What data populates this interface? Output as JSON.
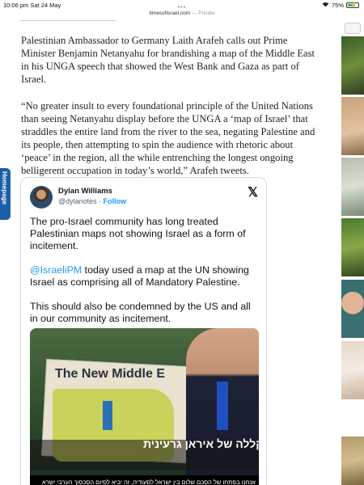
{
  "status": {
    "time": "10:06 pm",
    "date": "Sat 24 May",
    "battery": "75%",
    "battery_level": 0.75
  },
  "browser": {
    "url": "timesofisrael.com",
    "private_label": "Private",
    "dots": "•••"
  },
  "article": {
    "paragraphs": [
      "Palestinian Ambassador to Germany Laith Arafeh calls out Prime Minister Benjamin Netanyahu for brandishing a map of the Middle East in his UNGA speech that showed the West Bank and Gaza as part of Israel.",
      "“No greater insult to every foundational principle of the United Nations than seeing Netanyahu display before the UNGA a ‘map of Israel’ that straddles the entire land from the river to the sea, negating Palestine and its people, then attempting to spin the audience with rhetoric about ‘peace’ in the region, all the while entrenching the longest ongoing belligerent occupation in today’s world,” Arafeh tweets."
    ]
  },
  "homepage_tab": {
    "label": "Homepage"
  },
  "tweet": {
    "author_name": "Dylan Williams",
    "handle": "@dylanotes",
    "separator": " · ",
    "follow_label": "Follow",
    "platform_icon": "x-logo-icon",
    "paragraph1": "The pro-Israel community has long treated Palestinian maps not showing Israel as a form of incitement.",
    "mention": "@IsraeliPM",
    "paragraph2_rest": " today used a map at the UN showing Israel as comprising all of Mandatory Palestine.",
    "paragraph3": "This should also be condemned by the US and all in our community as incitement.",
    "image": {
      "map_title": "The New Middle E",
      "caption": "קללה של איראן גרעינית",
      "ticker": "אנחנו בפתחו של הסכם שלום בין ישראל לסעודיה, זה יביא לסיום הסכסוך הערבי ישרא"
    }
  },
  "colors": {
    "accent": "#1d9bf0",
    "homepage_tab": "#1b5fa8",
    "tie": "#1f4fc2"
  }
}
